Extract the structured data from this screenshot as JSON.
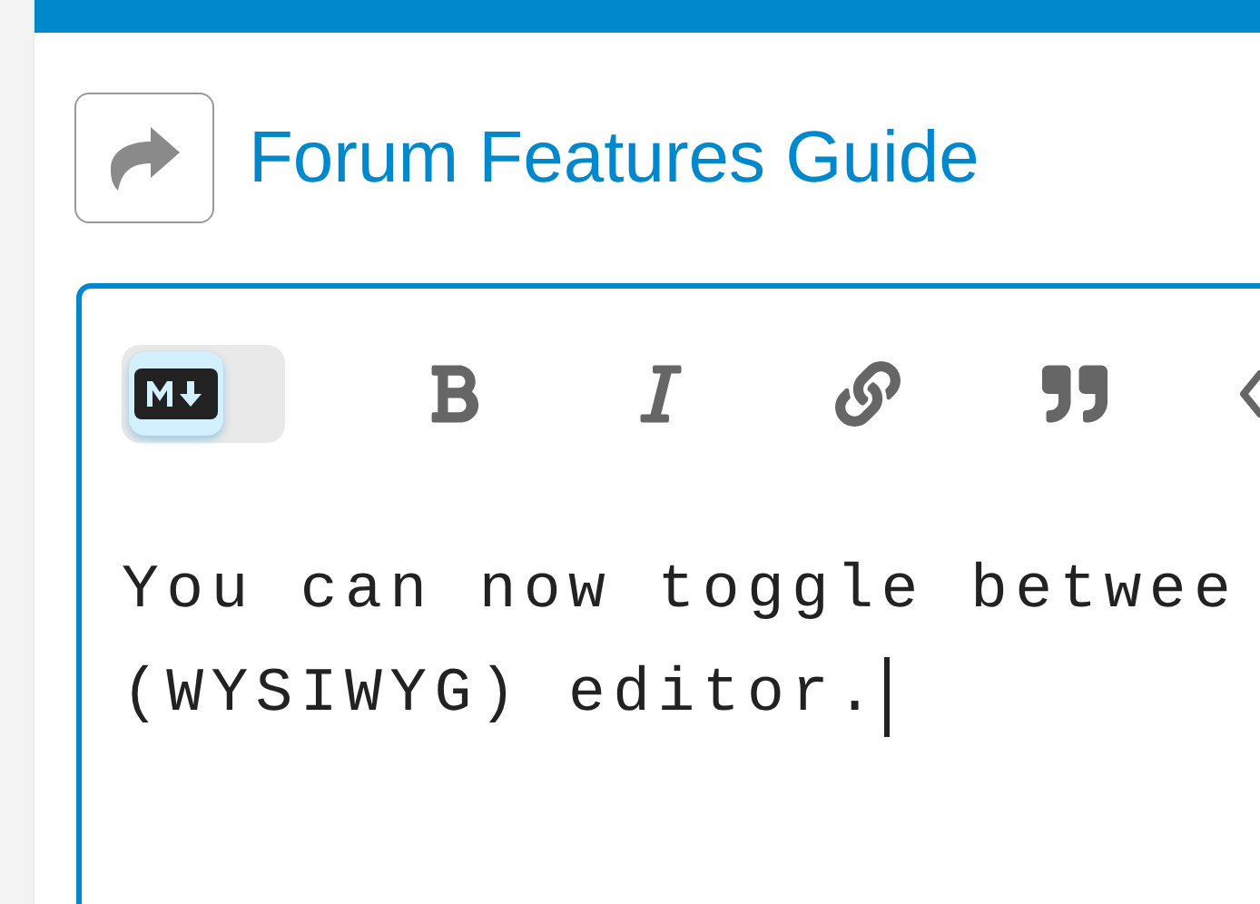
{
  "topic": {
    "title": "Forum Features Guide"
  },
  "editor": {
    "markdown_mode": true,
    "toolbar": [
      {
        "kind": "bold"
      },
      {
        "kind": "italic"
      },
      {
        "kind": "link"
      },
      {
        "kind": "quote"
      },
      {
        "kind": "code"
      }
    ],
    "lines": [
      "You can now toggle betwee",
      "(WYSIWYG) editor."
    ]
  }
}
